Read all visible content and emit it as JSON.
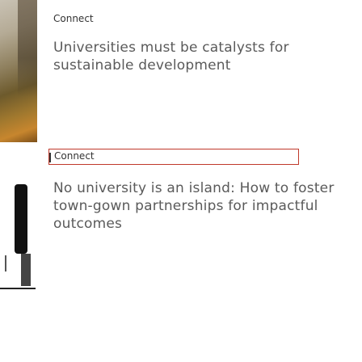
{
  "articles": [
    {
      "category": "Connect",
      "title": "Universities must be catalysts for sustainable development"
    },
    {
      "category": "Connect",
      "title": "No university is an island: How to foster town-gown partnerships for impactful outcomes"
    }
  ]
}
